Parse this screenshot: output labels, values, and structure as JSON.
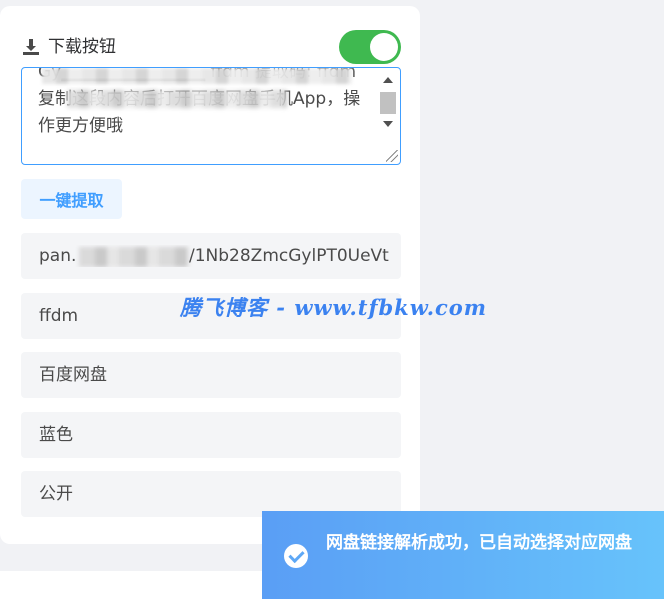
{
  "header": {
    "title": "下载按钮",
    "toggle_on": true
  },
  "textarea": {
    "value": "Gy▁▁▁▁▁▁▁▁▁▁▁ ffdm 提取码: ffdm 复制这段内容后打开百度网盘手机App，操作更方便哦"
  },
  "extract_button": {
    "label": "一键提取"
  },
  "fields": {
    "link_prefix": "pan.",
    "link_suffix": "/1Nb28ZmcGylPT0UeVt",
    "code": "ffdm",
    "disk": "百度网盘",
    "color": "蓝色",
    "visibility": "公开"
  },
  "watermark": "腾飞博客 - www.tfbkw.com",
  "toast": {
    "message": "网盘链接解析成功，已自动选择对应网盘"
  },
  "colors": {
    "toggle": "#3fb950",
    "accent": "#409eff",
    "toast_start": "#5a9ef5",
    "toast_end": "#67c3fb"
  }
}
